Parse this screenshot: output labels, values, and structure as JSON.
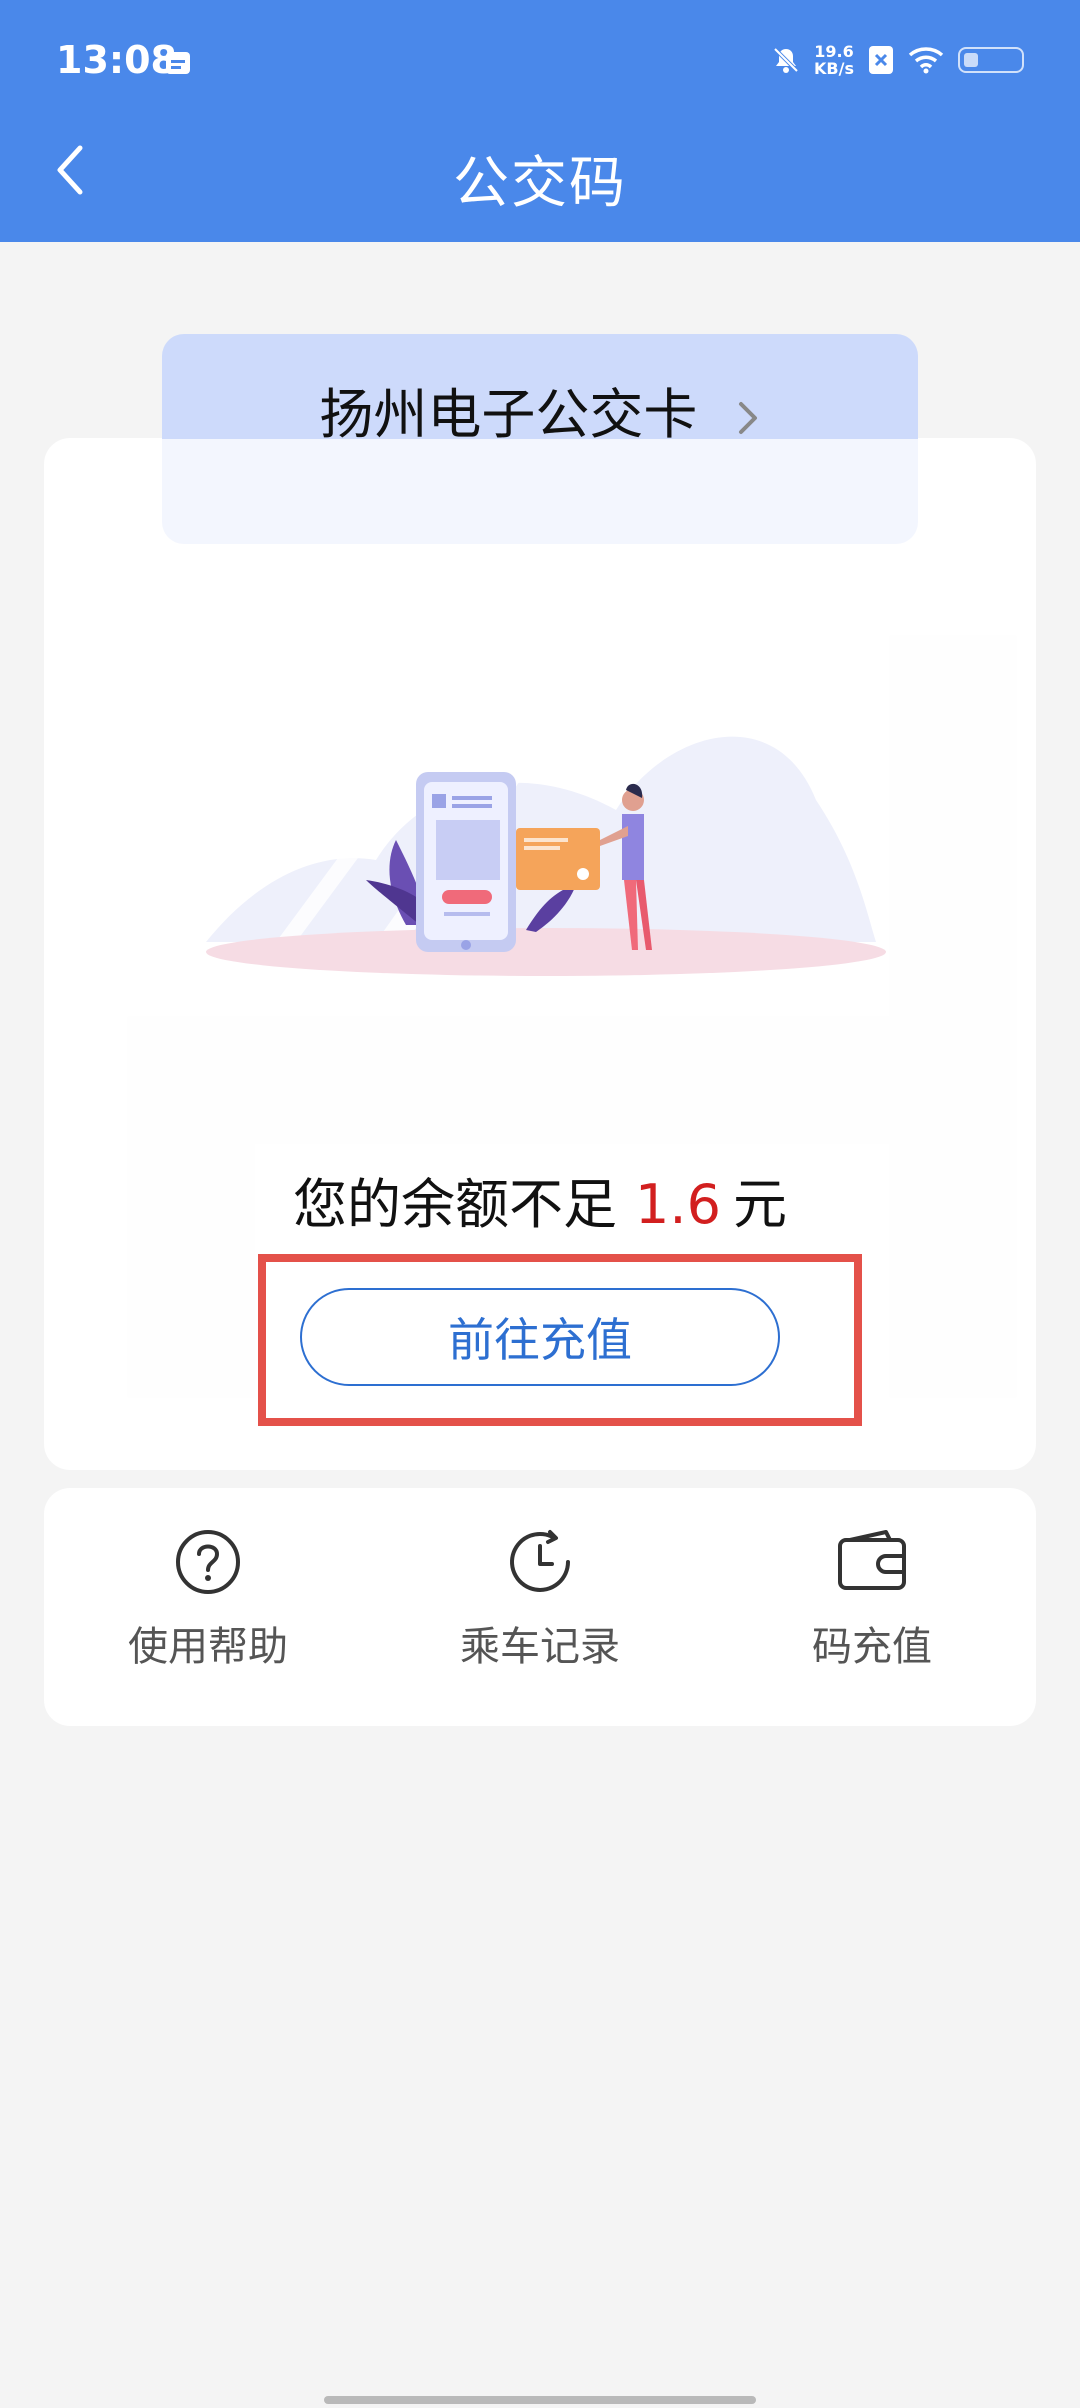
{
  "status_bar": {
    "time": "13:08",
    "net_speed_value": "19.6",
    "net_speed_unit": "KB/s"
  },
  "header": {
    "title": "公交码",
    "back_icon": "chevron-left-icon"
  },
  "card_selector": {
    "label": "扬州电子公交卡"
  },
  "balance": {
    "prefix": "您的余额不足",
    "amount": "1.6",
    "unit": "元"
  },
  "recharge_button": {
    "label": "前往充值"
  },
  "actions": [
    {
      "label": "使用帮助",
      "icon": "help-circle-icon"
    },
    {
      "label": "乘车记录",
      "icon": "clock-history-icon"
    },
    {
      "label": "码充值",
      "icon": "wallet-icon"
    }
  ],
  "colors": {
    "header": "#4a88ea",
    "accent": "#2d6fd1",
    "amount": "#d21f1f",
    "highlight": "#e4514a"
  }
}
